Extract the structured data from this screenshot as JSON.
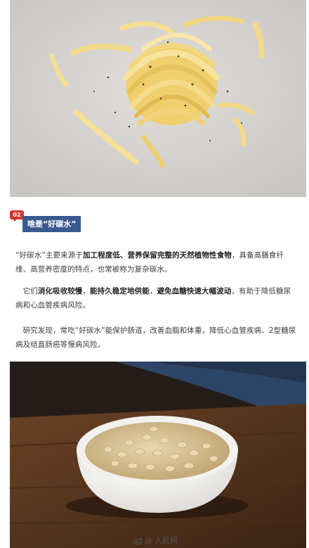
{
  "section": {
    "number": "02",
    "title": "啥是“好碳水”"
  },
  "paragraphs": {
    "p1": {
      "t1": "“好碳水”主要来源于",
      "b1": "加工程度低、营养保留完整的天然植物性食物",
      "t2": "，具备高膳食纤维、高营养密度的特点，也常被称为复杂碳水。"
    },
    "p2": {
      "t1": "它们",
      "b1": "消化吸收较慢",
      "t2": "，",
      "b2": "能持久稳定地供能",
      "t3": "，",
      "b3": "避免血糖快速大幅波动",
      "t4": "，有助于降低糖尿病和心血管疾病风险。"
    },
    "p3": {
      "t1": "研究发现，常吃“好碳水”能保护肠道，改善血脂和体重，降低心血管疾病、2型糖尿病及结直肠癌等慢病风险。"
    }
  },
  "watermark": {
    "icon": "weibo-icon",
    "at": "@",
    "text": "人民网"
  },
  "colors": {
    "badge": "#d6372e",
    "section_bg": "#395a8f",
    "pasta": "#f3d98a",
    "oats": "#dcc79d"
  }
}
